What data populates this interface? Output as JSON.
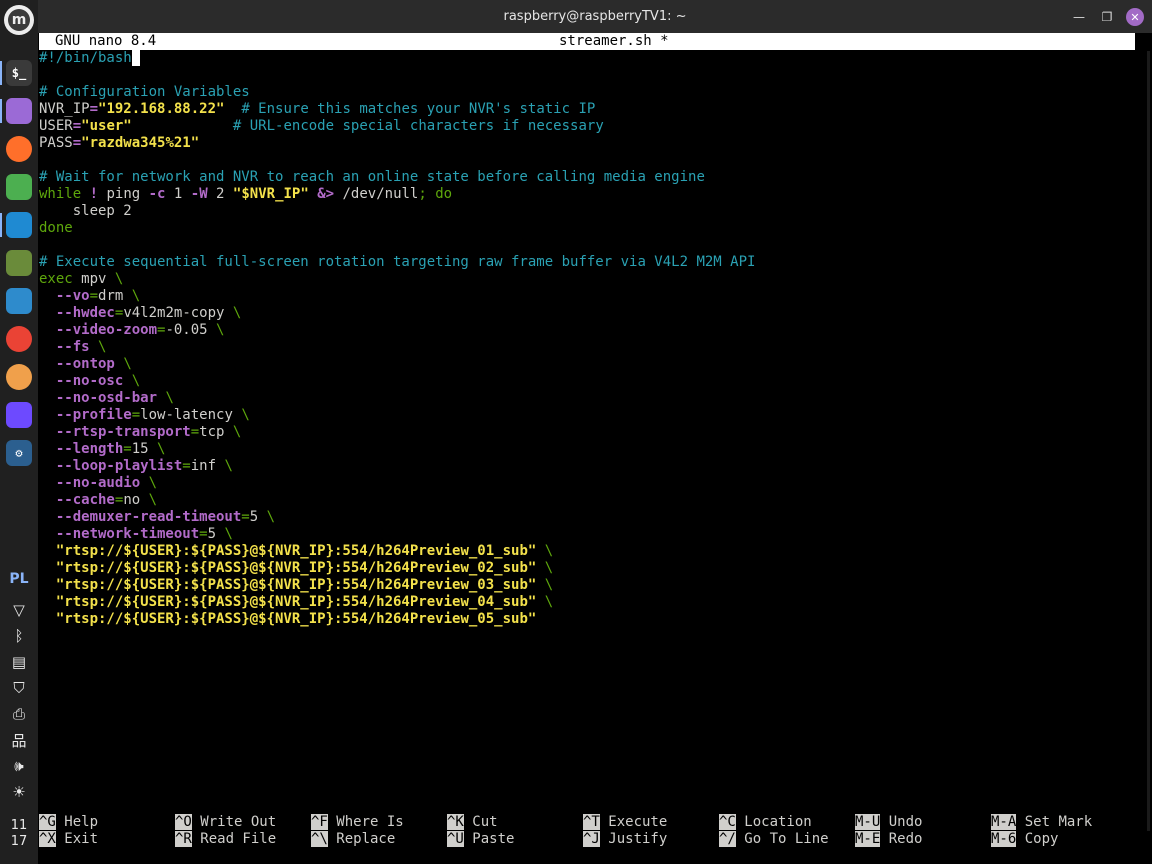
{
  "window": {
    "title": "raspberry@raspberryTV1: ~",
    "minimize_glyph": "—",
    "maximize_glyph": "❐",
    "close_glyph": "✕"
  },
  "panel": {
    "menu_glyph": "m",
    "apps": [
      {
        "name": "terminal-icon",
        "glyph": "$_",
        "color": "#3a3a3a"
      },
      {
        "name": "files-icon",
        "glyph": "",
        "color": "#9b6ad6"
      },
      {
        "name": "firefox-icon",
        "glyph": "",
        "color": "#ff6f2a"
      },
      {
        "name": "settings-toggle-icon",
        "glyph": "",
        "color": "#4caf50"
      },
      {
        "name": "vscode-icon",
        "glyph": "",
        "color": "#1f8ad2"
      },
      {
        "name": "network-manager-icon",
        "glyph": "",
        "color": "#6a8b3a"
      },
      {
        "name": "system-monitor-icon",
        "glyph": "",
        "color": "#2e8bcc"
      },
      {
        "name": "chrome-icon",
        "glyph": "",
        "color": "#ea4335"
      },
      {
        "name": "chromium-icon",
        "glyph": "",
        "color": "#f0a04b"
      },
      {
        "name": "proton-vpn-icon",
        "glyph": "",
        "color": "#6d4aff"
      },
      {
        "name": "gear-icon",
        "glyph": "⚙",
        "color": "#2b5f8f"
      }
    ],
    "language": "PL",
    "tray": [
      {
        "name": "vpn-tray-icon",
        "glyph": "▽"
      },
      {
        "name": "bluetooth-icon",
        "glyph": "ᛒ"
      },
      {
        "name": "clipboard-icon",
        "glyph": "▤"
      },
      {
        "name": "shield-icon",
        "glyph": "⛉"
      },
      {
        "name": "printer-icon",
        "glyph": "⎙"
      },
      {
        "name": "network-icon",
        "glyph": "品"
      },
      {
        "name": "volume-icon",
        "glyph": "🕪"
      },
      {
        "name": "brightness-icon",
        "glyph": "☀"
      }
    ],
    "clock_hour": "11",
    "clock_minute": "17"
  },
  "nano": {
    "version": "GNU nano 8.4",
    "filename": "streamer.sh *"
  },
  "colors": {
    "comment": "#2aa1b3",
    "keyword": "#5ea70c",
    "string": "#f3e14b",
    "option": "#b26bc9",
    "text": "#d0cfcc"
  },
  "code_lines": [
    [
      [
        "c",
        "#!/bin/bash"
      ],
      [
        "cur",
        " "
      ]
    ],
    [],
    [
      [
        "c",
        "# Configuration Variables"
      ]
    ],
    [
      [
        "var",
        "NVR_IP"
      ],
      [
        "op",
        "="
      ],
      [
        "str",
        "\"192.168.88.22\""
      ],
      [
        "var",
        "  "
      ],
      [
        "c",
        "# Ensure this matches your NVR's static IP"
      ]
    ],
    [
      [
        "var",
        "USER"
      ],
      [
        "op",
        "="
      ],
      [
        "str",
        "\"user\""
      ],
      [
        "var",
        "            "
      ],
      [
        "c",
        "# URL-encode special characters if necessary"
      ]
    ],
    [
      [
        "var",
        "PASS"
      ],
      [
        "op",
        "="
      ],
      [
        "str",
        "\"razdwa345%21\""
      ]
    ],
    [],
    [
      [
        "c",
        "# Wait for network and NVR to reach an online state before calling media engine"
      ]
    ],
    [
      [
        "kw",
        "while"
      ],
      [
        "var",
        " "
      ],
      [
        "op",
        "!"
      ],
      [
        "var",
        " ping "
      ],
      [
        "op",
        "-c"
      ],
      [
        "var",
        " 1 "
      ],
      [
        "op",
        "-W"
      ],
      [
        "var",
        " 2 "
      ],
      [
        "str",
        "\"$NVR_IP\""
      ],
      [
        "var",
        " "
      ],
      [
        "op",
        "&>"
      ],
      [
        "var",
        " /dev/null"
      ],
      [
        "kw",
        "; do"
      ]
    ],
    [
      [
        "var",
        "    sleep 2"
      ]
    ],
    [
      [
        "kw",
        "done"
      ]
    ],
    [],
    [
      [
        "c",
        "# Execute sequential full-screen rotation targeting raw frame buffer via V4L2 M2M API"
      ]
    ],
    [
      [
        "kw",
        "exec"
      ],
      [
        "var",
        " mpv "
      ],
      [
        "bs",
        "\\"
      ]
    ],
    [
      [
        "var",
        "  "
      ],
      [
        "op",
        "--vo"
      ],
      [
        "kw",
        "="
      ],
      [
        "var",
        "drm "
      ],
      [
        "bs",
        "\\"
      ]
    ],
    [
      [
        "var",
        "  "
      ],
      [
        "op",
        "--hwdec"
      ],
      [
        "kw",
        "="
      ],
      [
        "var",
        "v4l2m2m-copy "
      ],
      [
        "bs",
        "\\"
      ]
    ],
    [
      [
        "var",
        "  "
      ],
      [
        "op",
        "--video-zoom"
      ],
      [
        "kw",
        "="
      ],
      [
        "var",
        "-0.05 "
      ],
      [
        "bs",
        "\\"
      ]
    ],
    [
      [
        "var",
        "  "
      ],
      [
        "op",
        "--fs"
      ],
      [
        "var",
        " "
      ],
      [
        "bs",
        "\\"
      ]
    ],
    [
      [
        "var",
        "  "
      ],
      [
        "op",
        "--ontop"
      ],
      [
        "var",
        " "
      ],
      [
        "bs",
        "\\"
      ]
    ],
    [
      [
        "var",
        "  "
      ],
      [
        "op",
        "--no-osc"
      ],
      [
        "var",
        " "
      ],
      [
        "bs",
        "\\"
      ]
    ],
    [
      [
        "var",
        "  "
      ],
      [
        "op",
        "--no-osd-bar"
      ],
      [
        "var",
        " "
      ],
      [
        "bs",
        "\\"
      ]
    ],
    [
      [
        "var",
        "  "
      ],
      [
        "op",
        "--profile"
      ],
      [
        "kw",
        "="
      ],
      [
        "var",
        "low-latency "
      ],
      [
        "bs",
        "\\"
      ]
    ],
    [
      [
        "var",
        "  "
      ],
      [
        "op",
        "--rtsp-transport"
      ],
      [
        "kw",
        "="
      ],
      [
        "var",
        "tcp "
      ],
      [
        "bs",
        "\\"
      ]
    ],
    [
      [
        "var",
        "  "
      ],
      [
        "op",
        "--length"
      ],
      [
        "kw",
        "="
      ],
      [
        "var",
        "15 "
      ],
      [
        "bs",
        "\\"
      ]
    ],
    [
      [
        "var",
        "  "
      ],
      [
        "op",
        "--loop-playlist"
      ],
      [
        "kw",
        "="
      ],
      [
        "var",
        "inf "
      ],
      [
        "bs",
        "\\"
      ]
    ],
    [
      [
        "var",
        "  "
      ],
      [
        "op",
        "--no-audio"
      ],
      [
        "var",
        " "
      ],
      [
        "bs",
        "\\"
      ]
    ],
    [
      [
        "var",
        "  "
      ],
      [
        "op",
        "--cache"
      ],
      [
        "kw",
        "="
      ],
      [
        "var",
        "no "
      ],
      [
        "bs",
        "\\"
      ]
    ],
    [
      [
        "var",
        "  "
      ],
      [
        "op",
        "--demuxer-read-timeout"
      ],
      [
        "kw",
        "="
      ],
      [
        "var",
        "5 "
      ],
      [
        "bs",
        "\\"
      ]
    ],
    [
      [
        "var",
        "  "
      ],
      [
        "op",
        "--network-timeout"
      ],
      [
        "kw",
        "="
      ],
      [
        "var",
        "5 "
      ],
      [
        "bs",
        "\\"
      ]
    ],
    [
      [
        "var",
        "  "
      ],
      [
        "str",
        "\"rtsp://${USER}:${PASS}@${NVR_IP}:554/h264Preview_01_sub\""
      ],
      [
        "var",
        " "
      ],
      [
        "bs",
        "\\"
      ]
    ],
    [
      [
        "var",
        "  "
      ],
      [
        "str",
        "\"rtsp://${USER}:${PASS}@${NVR_IP}:554/h264Preview_02_sub\""
      ],
      [
        "var",
        " "
      ],
      [
        "bs",
        "\\"
      ]
    ],
    [
      [
        "var",
        "  "
      ],
      [
        "str",
        "\"rtsp://${USER}:${PASS}@${NVR_IP}:554/h264Preview_03_sub\""
      ],
      [
        "var",
        " "
      ],
      [
        "bs",
        "\\"
      ]
    ],
    [
      [
        "var",
        "  "
      ],
      [
        "str",
        "\"rtsp://${USER}:${PASS}@${NVR_IP}:554/h264Preview_04_sub\""
      ],
      [
        "var",
        " "
      ],
      [
        "bs",
        "\\"
      ]
    ],
    [
      [
        "var",
        "  "
      ],
      [
        "str",
        "\"rtsp://${USER}:${PASS}@${NVR_IP}:554/h264Preview_05_sub\""
      ]
    ]
  ],
  "shortcuts": [
    [
      {
        "key": "^G",
        "label": "Help"
      },
      {
        "key": "^X",
        "label": "Exit"
      }
    ],
    [
      {
        "key": "^O",
        "label": "Write Out"
      },
      {
        "key": "^R",
        "label": "Read File"
      }
    ],
    [
      {
        "key": "^F",
        "label": "Where Is"
      },
      {
        "key": "^\\",
        "label": "Replace"
      }
    ],
    [
      {
        "key": "^K",
        "label": "Cut"
      },
      {
        "key": "^U",
        "label": "Paste"
      }
    ],
    [
      {
        "key": "^T",
        "label": "Execute"
      },
      {
        "key": "^J",
        "label": "Justify"
      }
    ],
    [
      {
        "key": "^C",
        "label": "Location"
      },
      {
        "key": "^/",
        "label": "Go To Line"
      }
    ],
    [
      {
        "key": "M-U",
        "label": "Undo"
      },
      {
        "key": "M-E",
        "label": "Redo"
      }
    ],
    [
      {
        "key": "M-A",
        "label": "Set Mark"
      },
      {
        "key": "M-6",
        "label": "Copy"
      }
    ]
  ]
}
